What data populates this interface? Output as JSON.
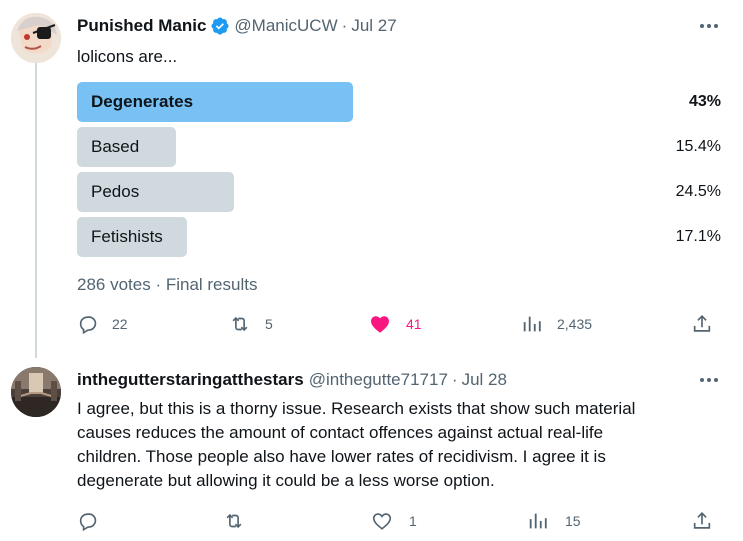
{
  "tweet": {
    "author_name": "Punished Manic",
    "handle": "@ManicUCW",
    "separator": "·",
    "date": "Jul 27",
    "text": "lolicons are...",
    "poll": {
      "options": [
        {
          "label": "Degenerates",
          "percent": "43%",
          "fraction": 0.43,
          "winner": true
        },
        {
          "label": "Based",
          "percent": "15.4%",
          "fraction": 0.154,
          "winner": false
        },
        {
          "label": "Pedos",
          "percent": "24.5%",
          "fraction": 0.245,
          "winner": false
        },
        {
          "label": "Fetishists",
          "percent": "17.1%",
          "fraction": 0.171,
          "winner": false
        }
      ],
      "summary": "286 votes · Final results"
    },
    "actions": {
      "replies": "22",
      "retweets": "5",
      "likes": "41",
      "views": "2,435"
    }
  },
  "reply": {
    "author_name": "inthegutterstaringatthestars",
    "handle": "@inthegutte71717",
    "separator": "·",
    "date": "Jul 28",
    "text_lines": [
      "I agree, but this is a thorny issue. Research exists that show such material",
      "causes reduces the amount of contact offences against actual real-life",
      "children. Those people also have lower rates of recidivism. I agree it is",
      "degenerate but allowing it could be a less worse option."
    ],
    "actions": {
      "replies": "",
      "retweets": "",
      "likes": "1",
      "views": "15"
    }
  },
  "colors": {
    "winner_bar": "#78c1f4",
    "other_bar": "#cfd9de",
    "like_active": "#f91880",
    "verified": "#1d9bf0",
    "muted_text": "#536471"
  }
}
